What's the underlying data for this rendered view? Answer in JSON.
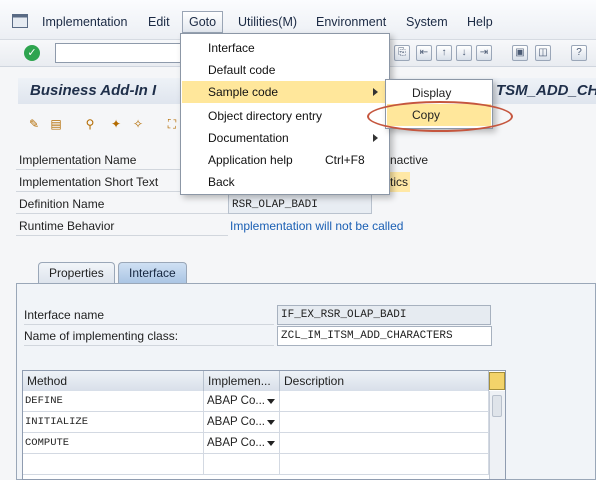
{
  "menubar": {
    "items": [
      {
        "label": "Implementation"
      },
      {
        "label": "Edit"
      },
      {
        "label": "Goto"
      },
      {
        "label": "Utilities(M)"
      },
      {
        "label": "Environment"
      },
      {
        "label": "System"
      },
      {
        "label": "Help"
      }
    ]
  },
  "header": {
    "title": "Business Add-In I",
    "title_right": "TSM_ADD_CH"
  },
  "form": {
    "impl_name_label": "Implementation Name",
    "impl_name_status": "nactive",
    "short_text_label": "Implementation Short Text",
    "short_text_value": "tics",
    "definition_label": "Definition Name",
    "definition_value": "RSR_OLAP_BADI",
    "runtime_label": "Runtime Behavior",
    "runtime_value": "Implementation will not be called"
  },
  "tabs": [
    {
      "label": "Properties"
    },
    {
      "label": "Interface"
    }
  ],
  "interface": {
    "name_label": "Interface name",
    "name_value": "IF_EX_RSR_OLAP_BADI",
    "class_label": "Name of implementing class:",
    "class_value": "ZCL_IM_ITSM_ADD_CHARACTERS"
  },
  "grid": {
    "columns": [
      "Method",
      "Implemen...",
      "Description"
    ],
    "rows": [
      {
        "method": "DEFINE",
        "impl": "ABAP Co..."
      },
      {
        "method": "INITIALIZE",
        "impl": "ABAP Co..."
      },
      {
        "method": "COMPUTE",
        "impl": "ABAP Co..."
      }
    ]
  },
  "goto_menu": {
    "items": [
      {
        "label": "Interface"
      },
      {
        "label": "Default code"
      },
      {
        "label": "Sample code"
      },
      {
        "label": "Object directory entry"
      },
      {
        "label": "Documentation"
      },
      {
        "label": "Application help",
        "shortcut": "Ctrl+F8"
      },
      {
        "label": "Back"
      }
    ]
  },
  "sample_code_submenu": {
    "items": [
      {
        "label": "Display"
      },
      {
        "label": "Copy"
      }
    ]
  },
  "colors": {
    "highlight": "#ffe79b",
    "annotation": "#c5563e"
  }
}
